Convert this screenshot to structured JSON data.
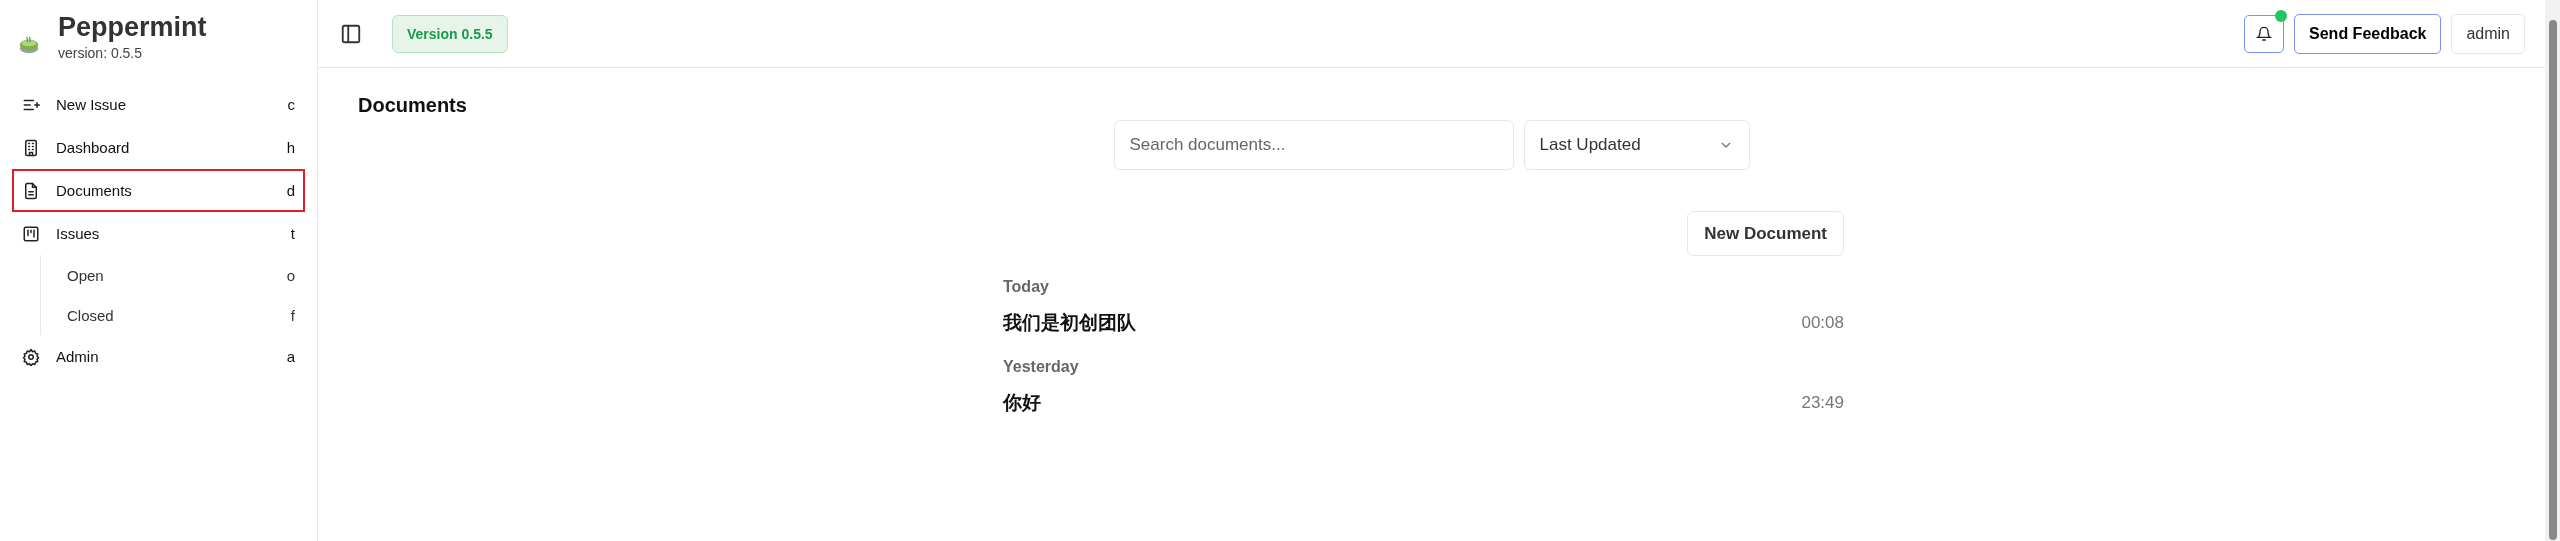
{
  "brand": {
    "name": "Peppermint",
    "version": "version: 0.5.5"
  },
  "sidebar": {
    "items": [
      {
        "label": "New Issue",
        "shortcut": "c",
        "selected": false
      },
      {
        "label": "Dashboard",
        "shortcut": "h",
        "selected": false
      },
      {
        "label": "Documents",
        "shortcut": "d",
        "selected": true
      },
      {
        "label": "Issues",
        "shortcut": "t",
        "selected": false,
        "children": [
          {
            "label": "Open",
            "shortcut": "o",
            "selected": false
          },
          {
            "label": "Closed",
            "shortcut": "f",
            "selected": false
          }
        ]
      },
      {
        "label": "Admin",
        "shortcut": "a",
        "selected": false
      }
    ]
  },
  "topbar": {
    "version_badge": "Version 0.5.5",
    "notification_dot": true,
    "feedback_button": "Send Feedback",
    "user_button": "admin"
  },
  "page": {
    "title": "Documents",
    "search": {
      "placeholder": "Search documents..."
    },
    "sort": {
      "value": "Last Updated"
    },
    "new_button": "New Document",
    "groups": [
      {
        "label": "Today",
        "documents": [
          {
            "title": "我们是初创团队",
            "time": "00:08"
          }
        ]
      },
      {
        "label": "Yesterday",
        "documents": [
          {
            "title": "你好",
            "time": "23:49"
          }
        ]
      }
    ]
  }
}
